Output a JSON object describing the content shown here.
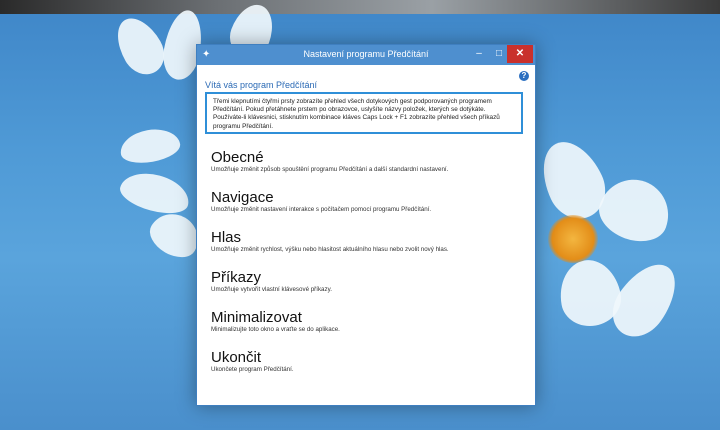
{
  "window": {
    "title": "Nastavení programu Předčítání"
  },
  "title_buttons": {
    "minimize": "–",
    "maximize": "□",
    "close": "✕"
  },
  "help_icon": "?",
  "welcome": "Vítá vás program Předčítání",
  "intro": "Třemi klepnutími čtyřmi prsty zobrazíte přehled všech dotykových gest podporovaných programem Předčítání. Pokud přetáhnete prstem po obrazovce, uslyšíte názvy položek, kterých se dotýkáte. Používáte-li klávesnici, stisknutím kombinace kláves Caps Lock + F1 zobrazíte přehled všech příkazů programu Předčítání.",
  "menu": [
    {
      "title": "Obecné",
      "desc": "Umožňuje změnit způsob spouštění programu Předčítání a další standardní nastavení."
    },
    {
      "title": "Navigace",
      "desc": "Umožňuje změnit nastavení interakce s počítačem pomocí programu Předčítání."
    },
    {
      "title": "Hlas",
      "desc": "Umožňuje změnit rychlost, výšku nebo hlasitost aktuálního hlasu nebo zvolit nový hlas."
    },
    {
      "title": "Příkazy",
      "desc": "Umožňuje vytvořit vlastní klávesové příkazy."
    },
    {
      "title": "Minimalizovat",
      "desc": "Minimalizujte toto okno a vraťte se do aplikace."
    },
    {
      "title": "Ukončit",
      "desc": "Ukončete program Předčítání."
    }
  ]
}
